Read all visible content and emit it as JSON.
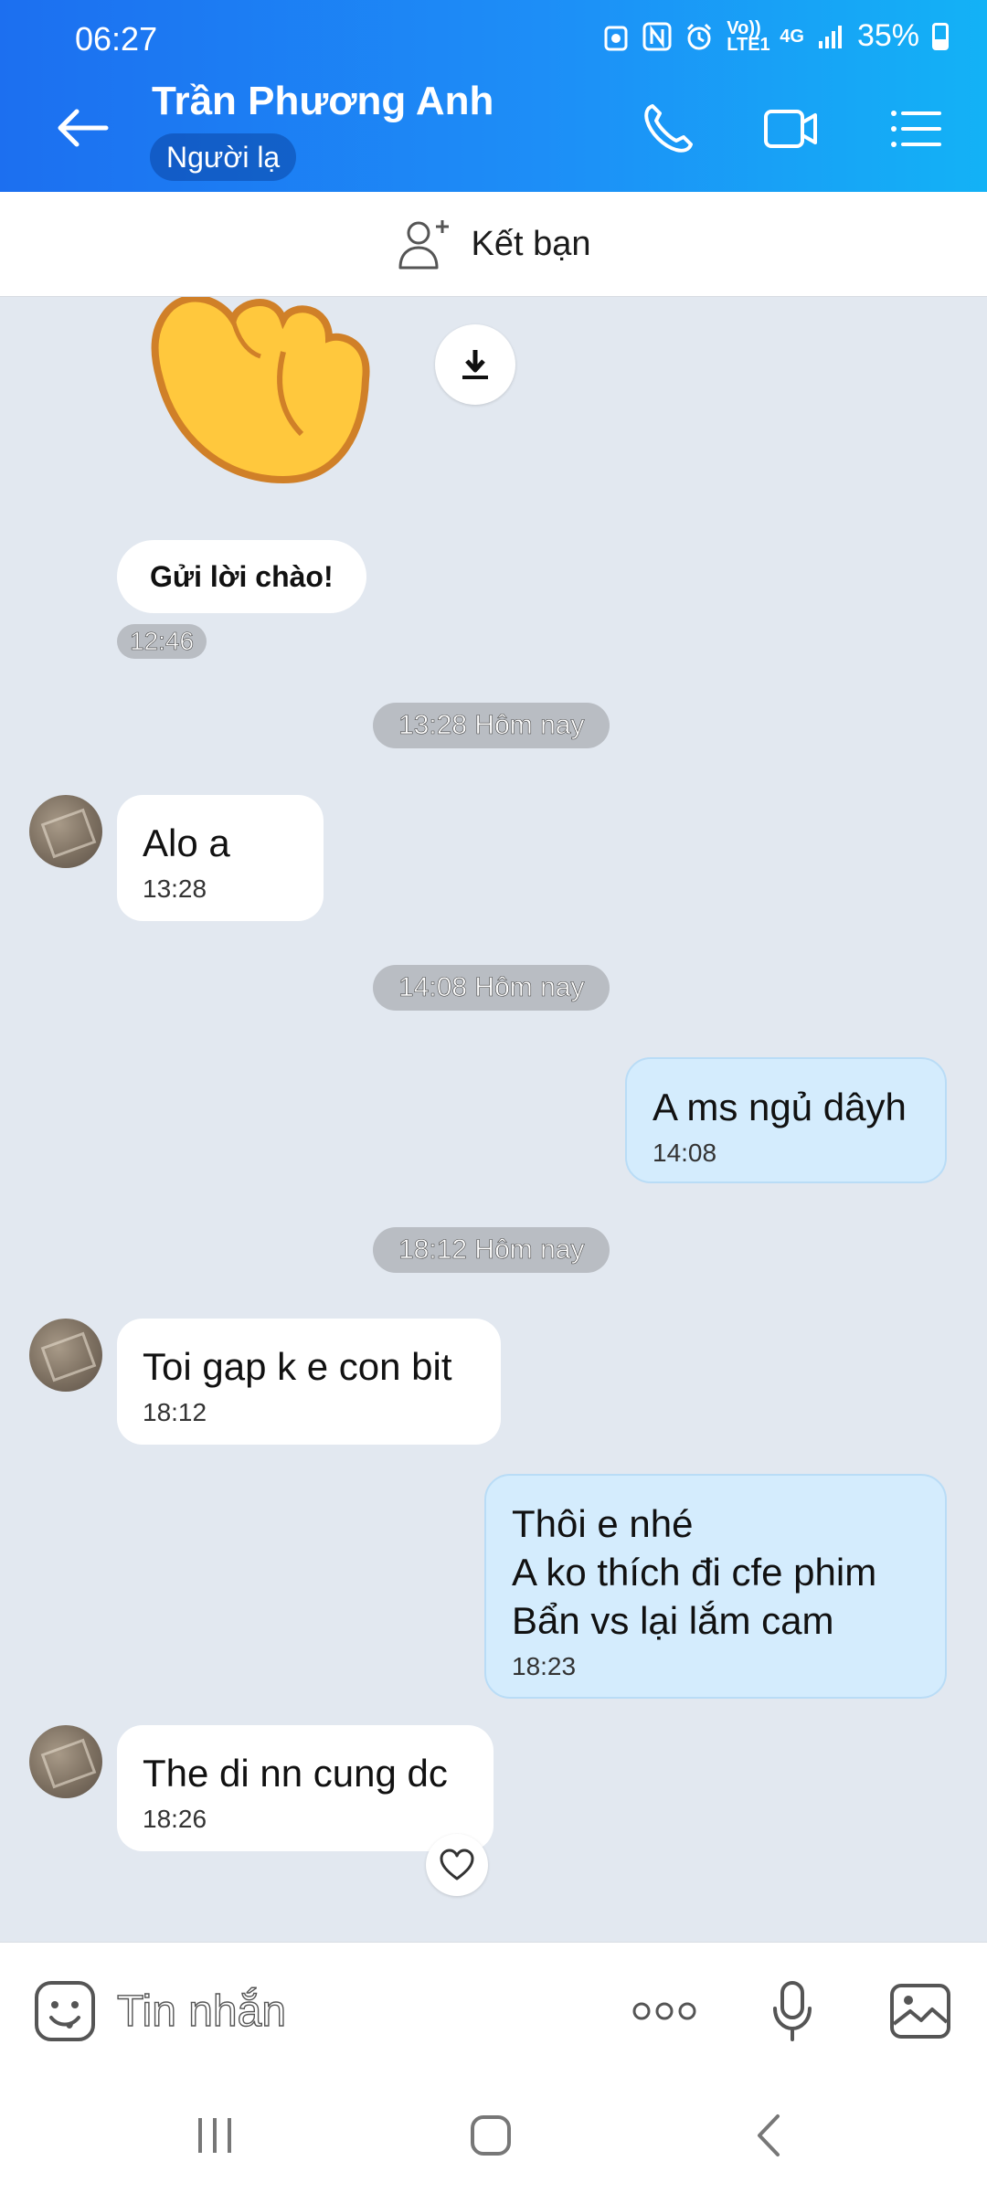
{
  "status": {
    "time": "06:27",
    "network": "4G",
    "volte": "Vo)) LTE1",
    "battery": "35%"
  },
  "header": {
    "name": "Trần Phương Anh",
    "badge": "Người lạ"
  },
  "friend_bar": {
    "label": "Kết bạn"
  },
  "chat": {
    "greeting": {
      "label": "Gửi lời chào!",
      "time": "12:46"
    },
    "separators": [
      "13:28 Hôm nay",
      "14:08 Hôm nay",
      "18:12 Hôm nay"
    ],
    "messages": [
      {
        "text": "Alo a",
        "time": "13:28",
        "from": "them"
      },
      {
        "text": "A ms ngủ dâyh",
        "time": "14:08",
        "from": "me"
      },
      {
        "text": "Toi gap k e con bit",
        "time": "18:12",
        "from": "them"
      },
      {
        "text": "Thôi e nhé\nA ko thích đi cfe phim\nBẩn vs lại lắm cam",
        "time": "18:23",
        "from": "me"
      },
      {
        "text": "The di nn cung dc",
        "time": "18:26",
        "from": "them"
      }
    ]
  },
  "input": {
    "placeholder": "Tin nhắn"
  },
  "colors": {
    "header_start": "#1c6ff0",
    "header_end": "#13b2f6",
    "my_bubble": "#d4ecfd",
    "chat_bg": "#e2e8f0"
  }
}
